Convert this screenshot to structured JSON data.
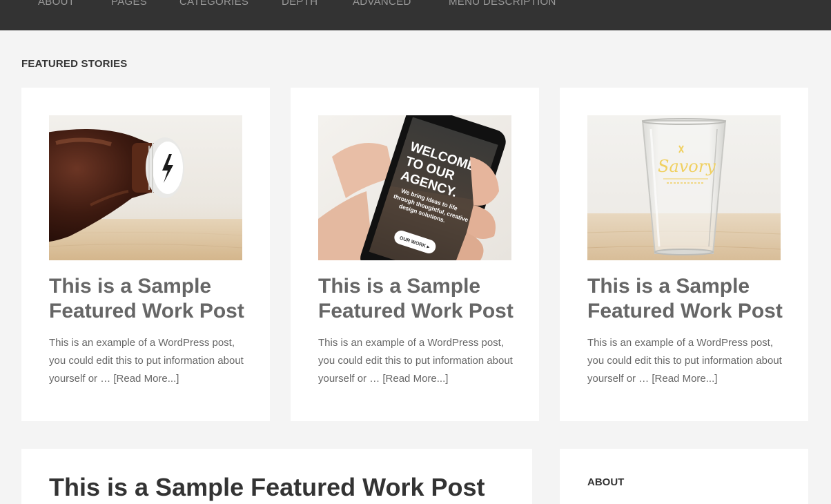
{
  "nav": {
    "items": [
      {
        "label": "ABOUT"
      },
      {
        "label": "PAGES"
      },
      {
        "label": "CATEGORIES"
      },
      {
        "label": "DEPTH"
      },
      {
        "label": "ADVANCED"
      },
      {
        "label": "MENU DESCRIPTION"
      }
    ]
  },
  "featured": {
    "heading": "FEATURED STORIES",
    "cards": [
      {
        "title": "This is a Sample Featured Work Post",
        "excerpt": "This is an example of a WordPress post, you could edit this to put information about yourself or … ",
        "read_more": "[Read More...]"
      },
      {
        "title": "This is a Sample Featured Work Post",
        "excerpt": "This is an example of a WordPress post, you could edit this to put information about yourself or … ",
        "read_more": "[Read More...]",
        "image_text": {
          "line1": "WELCOME",
          "line2": "TO OUR",
          "line3": "AGENCY.",
          "sub1": "We bring ideas to life",
          "sub2": "through thoughtful, creative",
          "sub3": "design solutions.",
          "button": "OUR WORK ▸"
        }
      },
      {
        "title": "This is a Sample Featured Work Post",
        "excerpt": "This is an example of a WordPress post, you could edit this to put information about yourself or … ",
        "read_more": "[Read More...]",
        "image_text": {
          "logo": "Savory"
        }
      }
    ]
  },
  "lower": {
    "post_title": "This is a Sample Featured Work Post",
    "widget_title": "ABOUT"
  },
  "colors": {
    "nav_bg": "#333333",
    "page_bg": "#f4f4f4",
    "card_bg": "#ffffff",
    "title_text": "#666666"
  }
}
